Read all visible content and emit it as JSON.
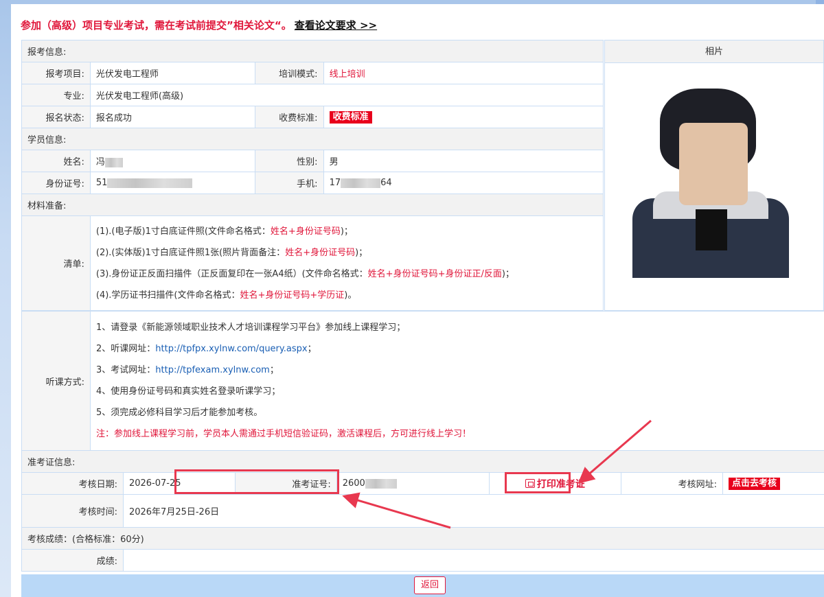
{
  "notice": {
    "text": "参加（高级）项目专业考试，需在考试前提交”相关论文“。",
    "link": "查看论文要求 >>"
  },
  "signup": {
    "section_title": "报考信息:",
    "project_label": "报考项目:",
    "project_value": "光伏发电工程师",
    "mode_label": "培训模式:",
    "mode_value": "线上培训",
    "major_label": "专业:",
    "major_value": "光伏发电工程师(高级)",
    "status_label": "报名状态:",
    "status_value": "报名成功",
    "fee_label": "收费标准:",
    "fee_value": "收费标准"
  },
  "student": {
    "section_title": "学员信息:",
    "name_label": "姓名:",
    "name_value": "冯",
    "gender_label": "性别:",
    "gender_value": "男",
    "id_label": "身份证号:",
    "id_value": "51",
    "phone_label": "手机:",
    "phone_prefix": "17",
    "phone_suffix": "64"
  },
  "photo": {
    "header": "相片"
  },
  "materials": {
    "section_title": "材料准备:",
    "list_label": "清单:",
    "items": [
      {
        "text": "(1).(电子版)1寸白底证件照(文件命名格式：",
        "highlight": "姓名+身份证号码",
        "end": ")；"
      },
      {
        "text": "(2).(实体版)1寸白底证件照1张(照片背面备注：",
        "highlight": "姓名+身份证号码",
        "end": ")；"
      },
      {
        "text": "(3).身份证正反面扫描件（正反面复印在一张A4纸）(文件命名格式：",
        "highlight": "姓名+身份证号码+身份证正/反面",
        "end": ")；"
      },
      {
        "text": "(4).学历证书扫描件(文件命名格式：",
        "highlight": "姓名+身份证号码+学历证",
        "end": ")。"
      }
    ]
  },
  "method": {
    "label": "听课方式:",
    "line1": "1、请登录《新能源领域职业技术人才培训课程学习平台》参加线上课程学习；",
    "line2_prefix": "2、听课网址：",
    "line2_url": "http://tpfpx.xylnw.com/query.aspx",
    "line2_end": "；",
    "line3_prefix": "3、考试网址：",
    "line3_url": "http://tpfexam.xylnw.com",
    "line3_end": "；",
    "line4": "4、使用身份证号码和真实姓名登录听课学习；",
    "line5": "5、须完成必修科目学习后才能参加考核。",
    "note": "注：参加线上课程学习前，学员本人需通过手机短信验证码，激活课程后，方可进行线上学习！"
  },
  "exam": {
    "section_title": "准考证信息:",
    "date_label": "考核日期:",
    "date_value": "2026-07-25",
    "ticket_label": "准考证号:",
    "ticket_value": "2600",
    "print_label": "打印准考证",
    "url_label": "考核网址:",
    "url_button": "点击去考核",
    "time_label": "考核时间:",
    "time_value": "2026年7月25日-26日"
  },
  "score": {
    "section_title": "考核成绩：(合格标准：60分)",
    "score_label": "成绩:",
    "score_value": ""
  },
  "footer": {
    "back_label": "返回"
  },
  "colors": {
    "accent_red": "#e0163a",
    "border_blue": "#c9ddf4",
    "footer_blue": "#b9d8f7",
    "link_blue": "#1a5fb4"
  }
}
